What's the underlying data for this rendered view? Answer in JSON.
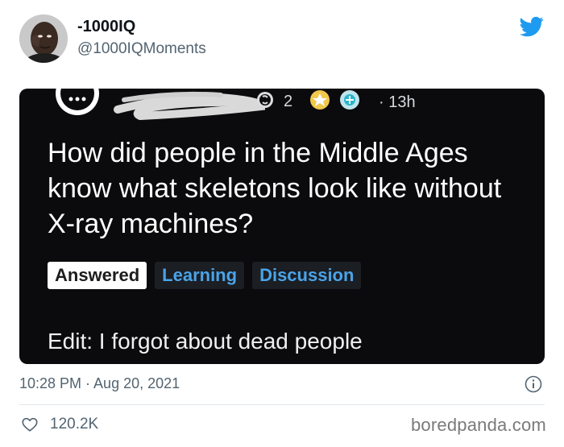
{
  "tweet": {
    "display_name": "-1000IQ",
    "handle": "@1000IQMoments",
    "timestamp": "10:28 PM · Aug 20, 2021",
    "likes": "120.2K"
  },
  "post": {
    "meta_time": "· 13h",
    "meta_count": "2",
    "title": "How did people in the Middle Ages know what skeletons look like without X-ray machines?",
    "flairs": [
      "Answered",
      "Learning",
      "Discussion"
    ],
    "body": "Edit: I forgot about dead people"
  },
  "watermark": "boredpanda.com",
  "colors": {
    "twitter_blue": "#1d9bf0",
    "flair_blue": "#4aa3e8",
    "card_bg": "#0b0b0d"
  },
  "icons": [
    "twitter-bird-icon",
    "info-icon",
    "heart-icon",
    "speech-bubble-icon",
    "silver-award-icon",
    "gold-award-icon",
    "platinum-award-icon"
  ]
}
